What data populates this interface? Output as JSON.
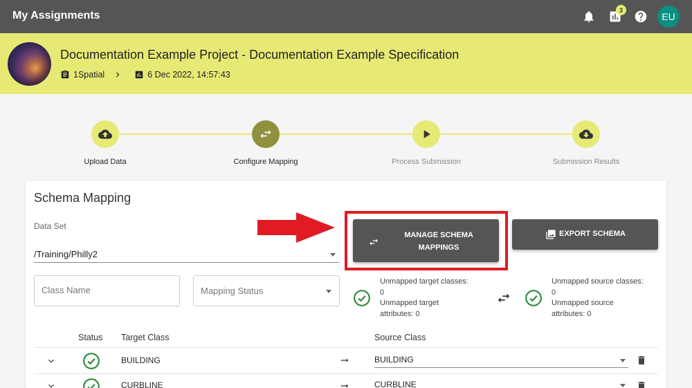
{
  "topbar": {
    "title": "My Assignments",
    "icons": [
      "bell-icon",
      "bar-chart-icon",
      "help-icon"
    ],
    "notification_count": "3",
    "user_initials": "EU"
  },
  "project": {
    "title": "Documentation Example Project - Documentation Example Specification",
    "org": "1Spatial",
    "date": "6 Dec 2022, 14:57:43"
  },
  "stepper": {
    "steps": [
      {
        "label": "Upload Data",
        "icon": "cloud-upload-icon"
      },
      {
        "label": "Configure Mapping",
        "icon": "swap-icon"
      },
      {
        "label": "Process Submission",
        "icon": "play-icon"
      },
      {
        "label": "Submission Results",
        "icon": "cloud-download-icon"
      }
    ],
    "current_step": 2
  },
  "schema": {
    "title": "Schema Mapping",
    "dataset_label": "Data Set",
    "dataset_value": "/Training/Philly2",
    "manage_button": "MANAGE SCHEMA MAPPINGS",
    "export_button": "EXPORT SCHEMA",
    "class_name_placeholder": "Class Name",
    "mapping_status_placeholder": "Mapping Status",
    "target_summary": {
      "classes_label": "Unmapped target classes:",
      "classes_value": "0",
      "attributes_label": "Unmapped target attributes: 0"
    },
    "source_summary": {
      "classes_label": "Unmapped source classes:",
      "classes_value": "0",
      "attributes_label": "Unmapped source attributes: 0"
    }
  },
  "table": {
    "headers": {
      "status": "Status",
      "target": "Target Class",
      "source": "Source Class"
    },
    "rows": [
      {
        "target": "BUILDING",
        "source": "BUILDING"
      },
      {
        "target": "CURBLINE",
        "source": "CURBLINE"
      }
    ]
  },
  "colors": {
    "topbar": "#555555",
    "accent": "#e6ea75",
    "accent_dark": "#8f913d",
    "highlight": "#e01b24",
    "success": "#2e8b3a"
  }
}
